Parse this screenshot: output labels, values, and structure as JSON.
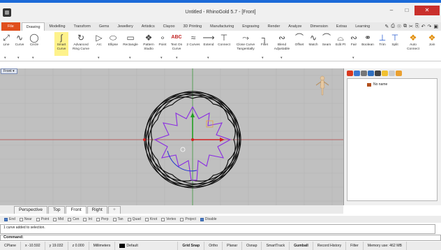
{
  "window": {
    "title": "Untitled - RhinoGold 5.7 - [Front]"
  },
  "menubar": {
    "items": [
      "File",
      "Drawing",
      "Modelling",
      "Transform",
      "Gems",
      "Jewellery",
      "Artistics",
      "Clayoo",
      "3D Printing",
      "Manufacturing",
      "Engraving",
      "Render",
      "Analyze",
      "Dimension",
      "Extras",
      "Learning"
    ]
  },
  "ribbon": {
    "tools": [
      "Line",
      "Curve",
      "Circle",
      "Smart Curve",
      "Advanced Ring Curve",
      "Arc",
      "Ellipse",
      "Rectangle",
      "Pattern Studio",
      "Point",
      "Text On Curve",
      "2 Curves",
      "Extend",
      "Connect",
      "Close Curve Tangentially",
      "Fillet",
      "Blend Adjustable",
      "Offset",
      "Match",
      "Seam",
      "Edit Pt",
      "Fair",
      "Boolean",
      "Trim",
      "Split",
      "Auto Connect",
      "Join"
    ],
    "text_on_curve_glyph": "ABC"
  },
  "viewport": {
    "label": "Front"
  },
  "view_tabs": [
    "Perspective",
    "Top",
    "Front",
    "Right"
  ],
  "layers": {
    "default_name": "No name"
  },
  "osnap": {
    "items": [
      "End",
      "Near",
      "Point",
      "Mid",
      "Cen",
      "Int",
      "Perp",
      "Tan",
      "Quad",
      "Knot",
      "Vertex",
      "Project",
      "Disable"
    ]
  },
  "history_text": "1 curve added to selection.",
  "command_label": "Command:",
  "status": {
    "cplane": "CPlane",
    "x": "x -10.592",
    "y": "y 19.032",
    "z": "z 0.000",
    "units": "Millimeters",
    "layer": "Default",
    "toggles": [
      "Grid Snap",
      "Ortho",
      "Planar",
      "Osnap",
      "SmartTrack",
      "Gumball",
      "Record History",
      "Filter"
    ],
    "memory": "Memory use: 462 MB"
  },
  "colors": {
    "accent": "#1c6ad8",
    "file_tab": "#e04f1d",
    "highlight": "#fef28b",
    "viewport_bg": "#c0c0c0",
    "curve_black": "#111111",
    "curve_purple": "#8a2be2",
    "axis_red": "#d22020",
    "axis_green": "#20a020",
    "axis_blue": "#2030d0"
  }
}
